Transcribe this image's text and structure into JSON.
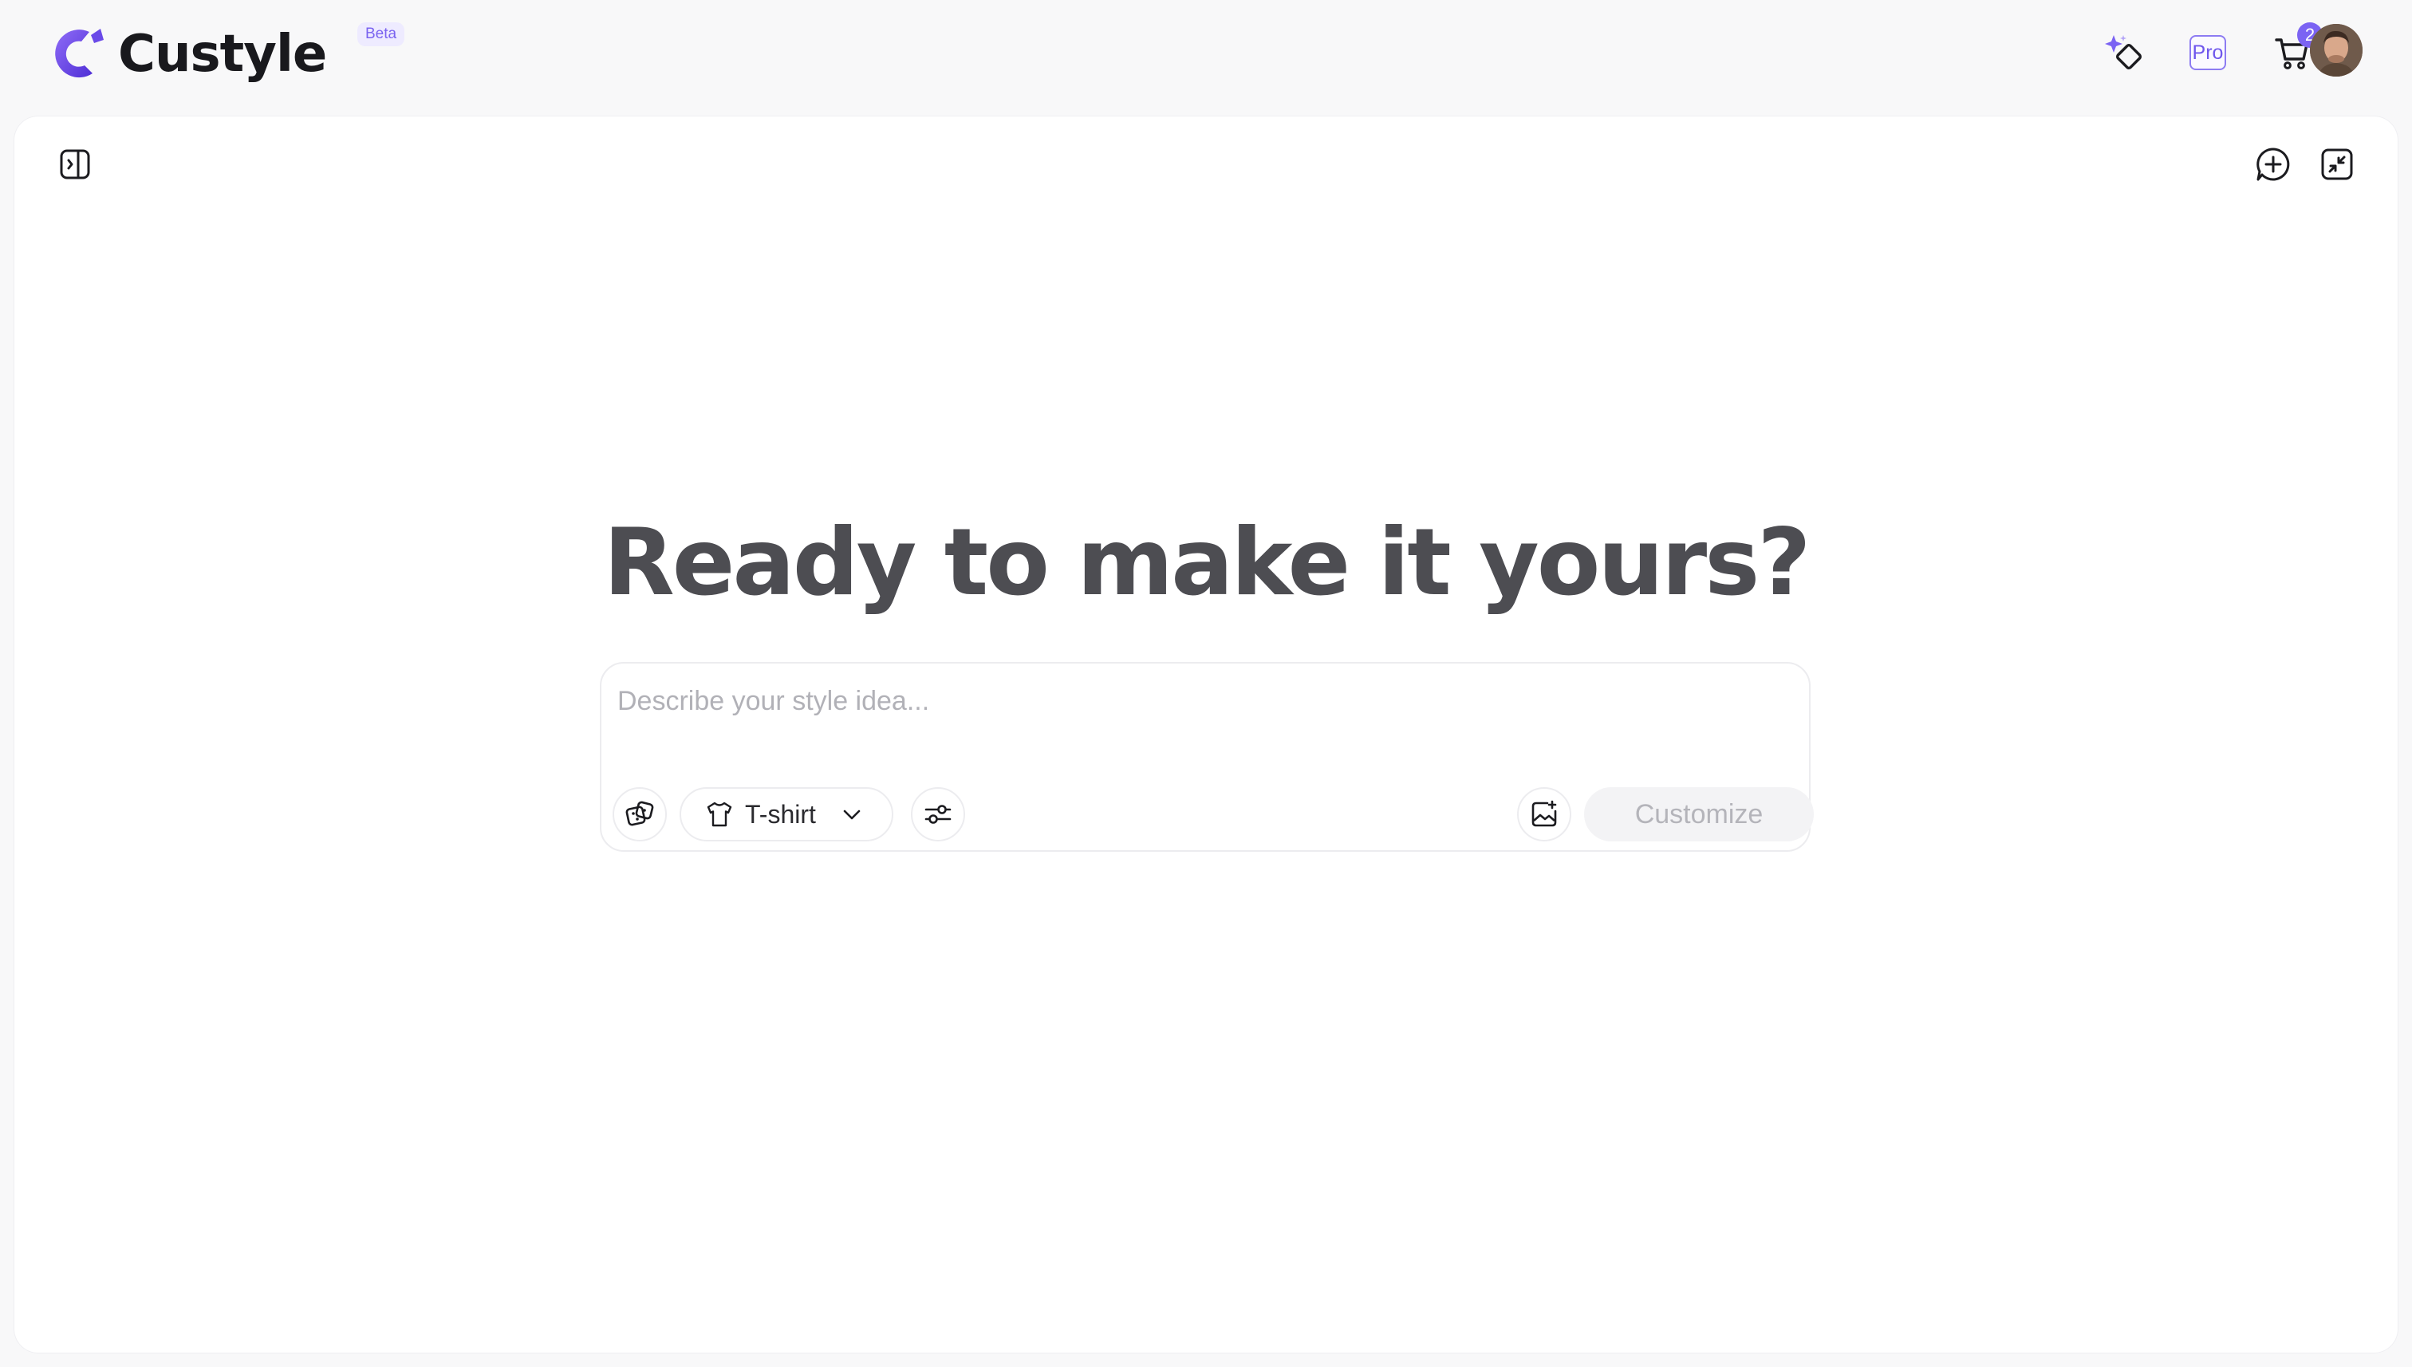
{
  "header": {
    "brand": "Custyle",
    "badge": "Beta",
    "pro_label": "Pro",
    "cart_count": "2",
    "accent_color": "#7b63f3"
  },
  "main": {
    "title": "Ready to make it yours?",
    "composer": {
      "placeholder": "Describe your style idea...",
      "value": "",
      "product_type": "T-shirt",
      "submit_label": "Customize"
    }
  },
  "icons": {
    "logo": "custyle-logo-icon",
    "sparkle": "sparkle-icon",
    "cart": "cart-icon",
    "sidebar": "sidebar-toggle-icon",
    "new_chat": "new-chat-icon",
    "collapse": "collapse-icon",
    "dice": "dice-icon",
    "shirt": "tshirt-icon",
    "chevron": "chevron-down-icon",
    "filters": "sliders-icon",
    "image": "image-upload-icon"
  }
}
